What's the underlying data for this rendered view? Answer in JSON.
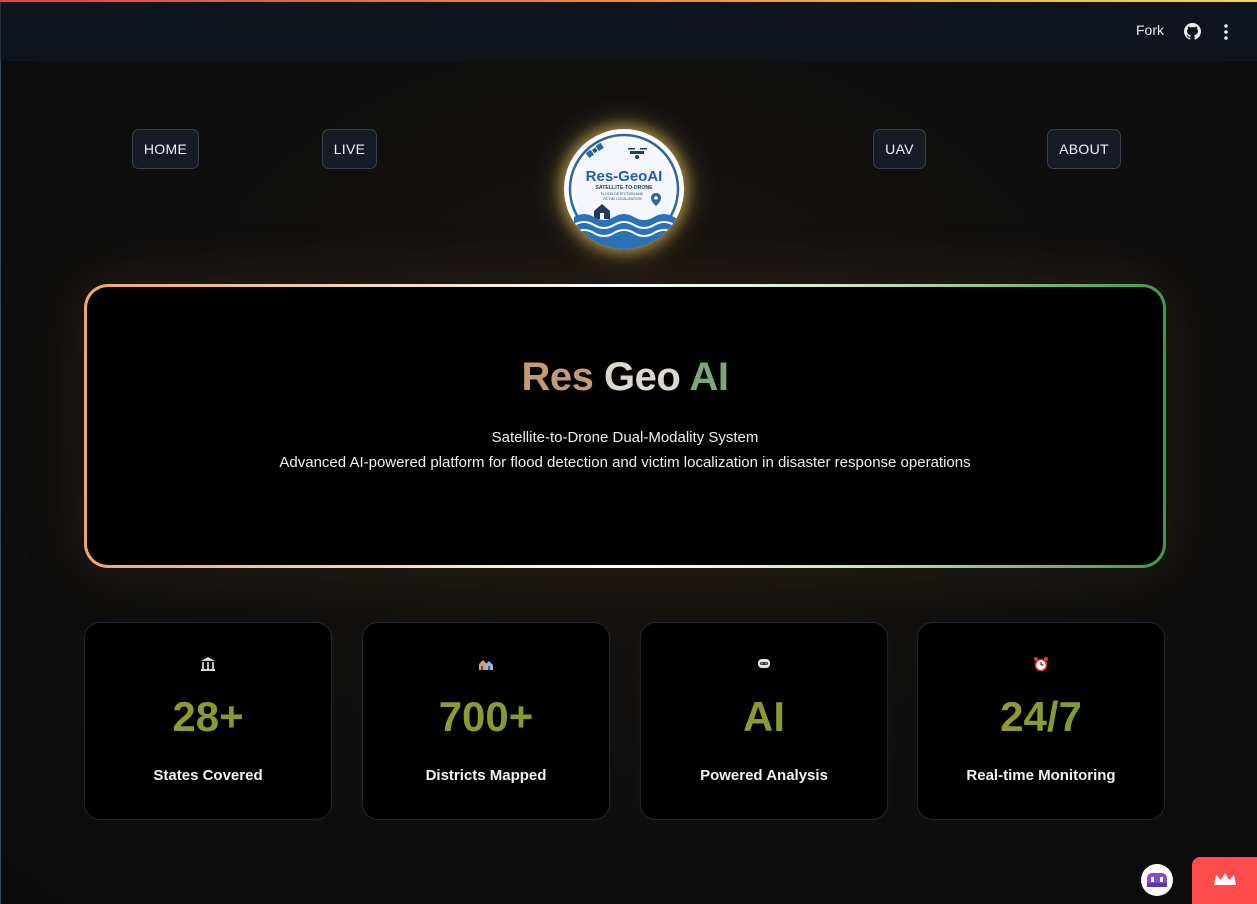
{
  "header": {
    "fork_label": "Fork"
  },
  "nav": {
    "home": "HOME",
    "live": "LIVE",
    "uav": "UAV",
    "about": "ABOUT"
  },
  "logo": {
    "title": "Res-GeoAI",
    "line1": "SATELLITE-TO-DRONE",
    "line2": "FLOOD DETECTION AND",
    "line3": "VICTIM LOCALIZATION"
  },
  "hero": {
    "title_part1": "Res",
    "title_part2": "Geo",
    "title_part3": "AI",
    "subtitle": "Satellite-to-Drone Dual-Modality System",
    "description": "Advanced AI-powered platform for flood detection and victim localization in disaster response operations"
  },
  "stats": [
    {
      "icon": "classical-building-icon",
      "value": "28+",
      "label": "States Covered"
    },
    {
      "icon": "houses-icon",
      "value": "700+",
      "label": "Districts Mapped"
    },
    {
      "icon": "robot-icon",
      "value": "AI",
      "label": "Powered Analysis"
    },
    {
      "icon": "alarm-clock-icon",
      "value": "24/7",
      "label": "Real-time Monitoring"
    }
  ],
  "colors": {
    "accent_red": "#ff4b4b",
    "stat_gradient_start": "#a9962e",
    "stat_gradient_end": "#6e9d35",
    "hero_border_left": "#f2a567",
    "hero_border_right": "#3c9b3f"
  }
}
